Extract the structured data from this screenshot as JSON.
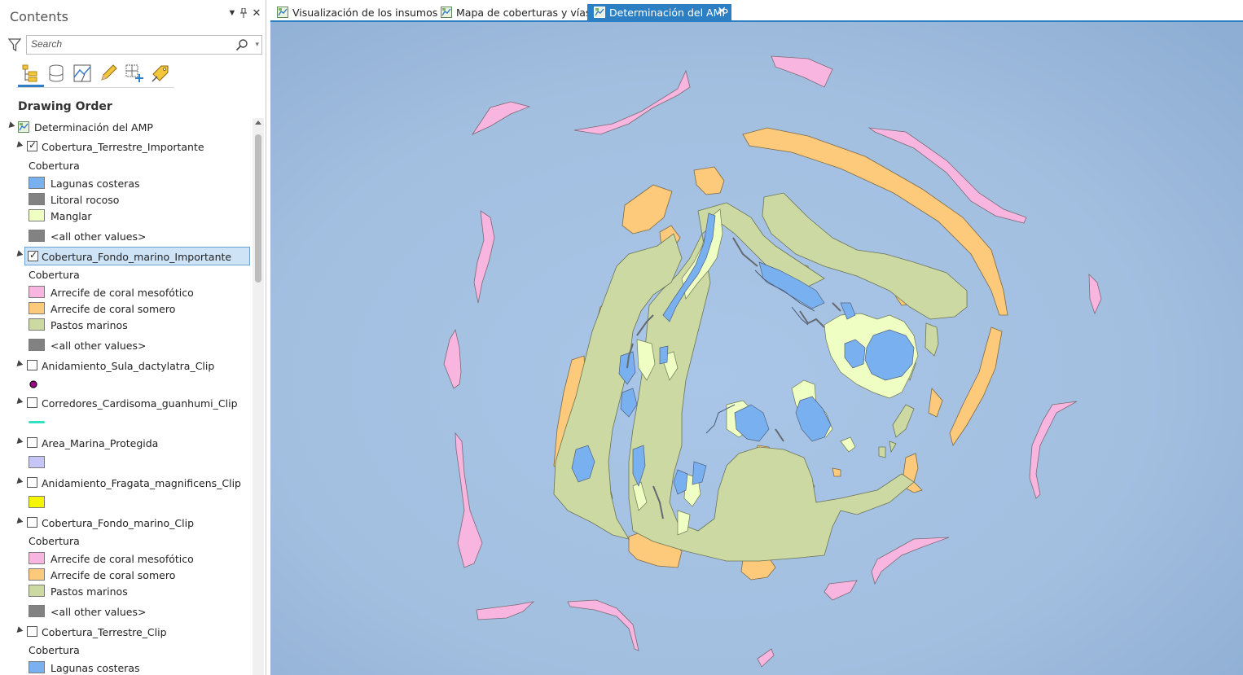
{
  "pane": {
    "title": "Contents",
    "search_placeholder": "Search",
    "drawing_order": "Drawing Order"
  },
  "tree": {
    "root": "Determinación del AMP",
    "layers": [
      {
        "name": "Cobertura_Terrestre_Importante",
        "checked": true,
        "heading": "Cobertura",
        "classes": [
          {
            "label": "Lagunas costeras",
            "color": "#79b0f0"
          },
          {
            "label": "Litoral rocoso",
            "color": "#828282"
          },
          {
            "label": "Manglar",
            "color": "#efffc4"
          },
          {
            "label": "<all other values>",
            "color": "#828282"
          }
        ]
      },
      {
        "name": "Cobertura_Fondo_marino_Importante",
        "checked": true,
        "heading": "Cobertura",
        "classes": [
          {
            "label": "Arrecife de coral mesofótico",
            "color": "#f7b5df"
          },
          {
            "label": "Arrecife de coral somero",
            "color": "#fdc97a"
          },
          {
            "label": "Pastos marinos",
            "color": "#ccd9a3"
          },
          {
            "label": "<all other values>",
            "color": "#828282"
          }
        ]
      },
      {
        "name": "Anidamiento_Sula_dactylatra_Clip",
        "checked": false
      },
      {
        "name": "Corredores_Cardisoma_guanhumi_Clip",
        "checked": false
      },
      {
        "name": "Area_Marina_Protegida",
        "checked": false
      },
      {
        "name": "Anidamiento_Fragata_magnificens_Clip",
        "checked": false
      },
      {
        "name": "Cobertura_Fondo_marino_Clip",
        "checked": false,
        "heading": "Cobertura",
        "classes": [
          {
            "label": "Arrecife de coral mesofótico",
            "color": "#f7b5df"
          },
          {
            "label": "Arrecife de coral somero",
            "color": "#fdc97a"
          },
          {
            "label": "Pastos marinos",
            "color": "#ccd9a3"
          },
          {
            "label": "<all other values>",
            "color": "#828282"
          }
        ]
      },
      {
        "name": "Cobertura_Terrestre_Clip",
        "checked": false,
        "heading": "Cobertura",
        "classes": [
          {
            "label": "Lagunas costeras",
            "color": "#79b0f0"
          }
        ]
      }
    ]
  },
  "tabs": [
    {
      "label": "Visualización de los insumos"
    },
    {
      "label": "Mapa de coberturas y vías"
    },
    {
      "label": "Determinación del AMP",
      "active": true
    }
  ],
  "map": {
    "ocean_color": "#a3bfe0",
    "legend_colors": {
      "mesophotic": "#f7b5df",
      "shallow_reef": "#fdc97a",
      "seagrass": "#ccd9a3",
      "mangrove": "#efffc4",
      "lagoon": "#79b0f0",
      "rocky": "#828282"
    }
  },
  "symbols": {
    "sula_point_color": "#a3008e",
    "cardisoma_line_color": "#33e0c2",
    "amp_fill": "#c5c6f5",
    "fragata_fill": "#f5f500"
  }
}
